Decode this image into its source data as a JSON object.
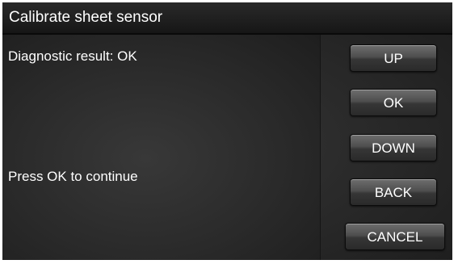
{
  "window": {
    "title": "Calibrate sheet sensor"
  },
  "content": {
    "result_text": "Diagnostic result: OK",
    "instruction_text": "Press OK to continue"
  },
  "buttons": {
    "up": "UP",
    "ok": "OK",
    "down": "DOWN",
    "back": "BACK",
    "cancel": "CANCEL"
  },
  "colors": {
    "background": "#2b2b2b",
    "text": "#ffffff",
    "button_top": "#6e6e6e",
    "button_bottom": "#2a2a2a"
  }
}
